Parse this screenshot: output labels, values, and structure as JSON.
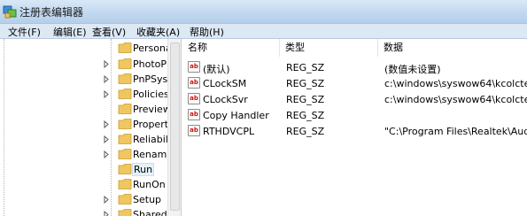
{
  "window": {
    "title": "注册表编辑器",
    "icon": "regedit-icon"
  },
  "menu": [
    "文件(F)",
    "编辑(E)",
    "查看(V)",
    "收藏夹(A)",
    "帮助(H)"
  ],
  "tree": {
    "items": [
      {
        "label": "Persona",
        "expander": "none"
      },
      {
        "label": "PhotoP",
        "expander": "collapsed"
      },
      {
        "label": "PnPSys",
        "expander": "collapsed"
      },
      {
        "label": "Policies",
        "expander": "collapsed"
      },
      {
        "label": "Preview",
        "expander": "none"
      },
      {
        "label": "Propert",
        "expander": "collapsed"
      },
      {
        "label": "Reliabil",
        "expander": "collapsed"
      },
      {
        "label": "Renam",
        "expander": "collapsed"
      },
      {
        "label": "Run",
        "expander": "none",
        "selected": true
      },
      {
        "label": "RunOn",
        "expander": "none"
      },
      {
        "label": "Setup",
        "expander": "collapsed"
      },
      {
        "label": "SharedI",
        "expander": "collapsed"
      }
    ]
  },
  "list": {
    "columns": [
      "名称",
      "类型",
      "数据"
    ],
    "rows": [
      {
        "name": "(默认)",
        "type": "REG_SZ",
        "data": "(数值未设置)",
        "icon": "string-value-icon"
      },
      {
        "name": "CLockSM",
        "type": "REG_SZ",
        "data": "c:\\windows\\syswow64\\kcolcte",
        "icon": "string-value-icon"
      },
      {
        "name": "CLockSvr",
        "type": "REG_SZ",
        "data": "c:\\windows\\syswow64\\kcolcte",
        "icon": "string-value-icon"
      },
      {
        "name": "Copy Handler",
        "type": "REG_SZ",
        "data": "",
        "icon": "string-value-icon"
      },
      {
        "name": "RTHDVCPL",
        "type": "REG_SZ",
        "data": "\"C:\\Program Files\\Realtek\\Aud",
        "icon": "string-value-icon"
      }
    ]
  },
  "colors": {
    "titlebar": "#c2d8ef",
    "menubar": "#dde8f5",
    "folder": "#f0c75e",
    "selection": "#e5f1fb",
    "value_icon_text": "#d01010"
  }
}
